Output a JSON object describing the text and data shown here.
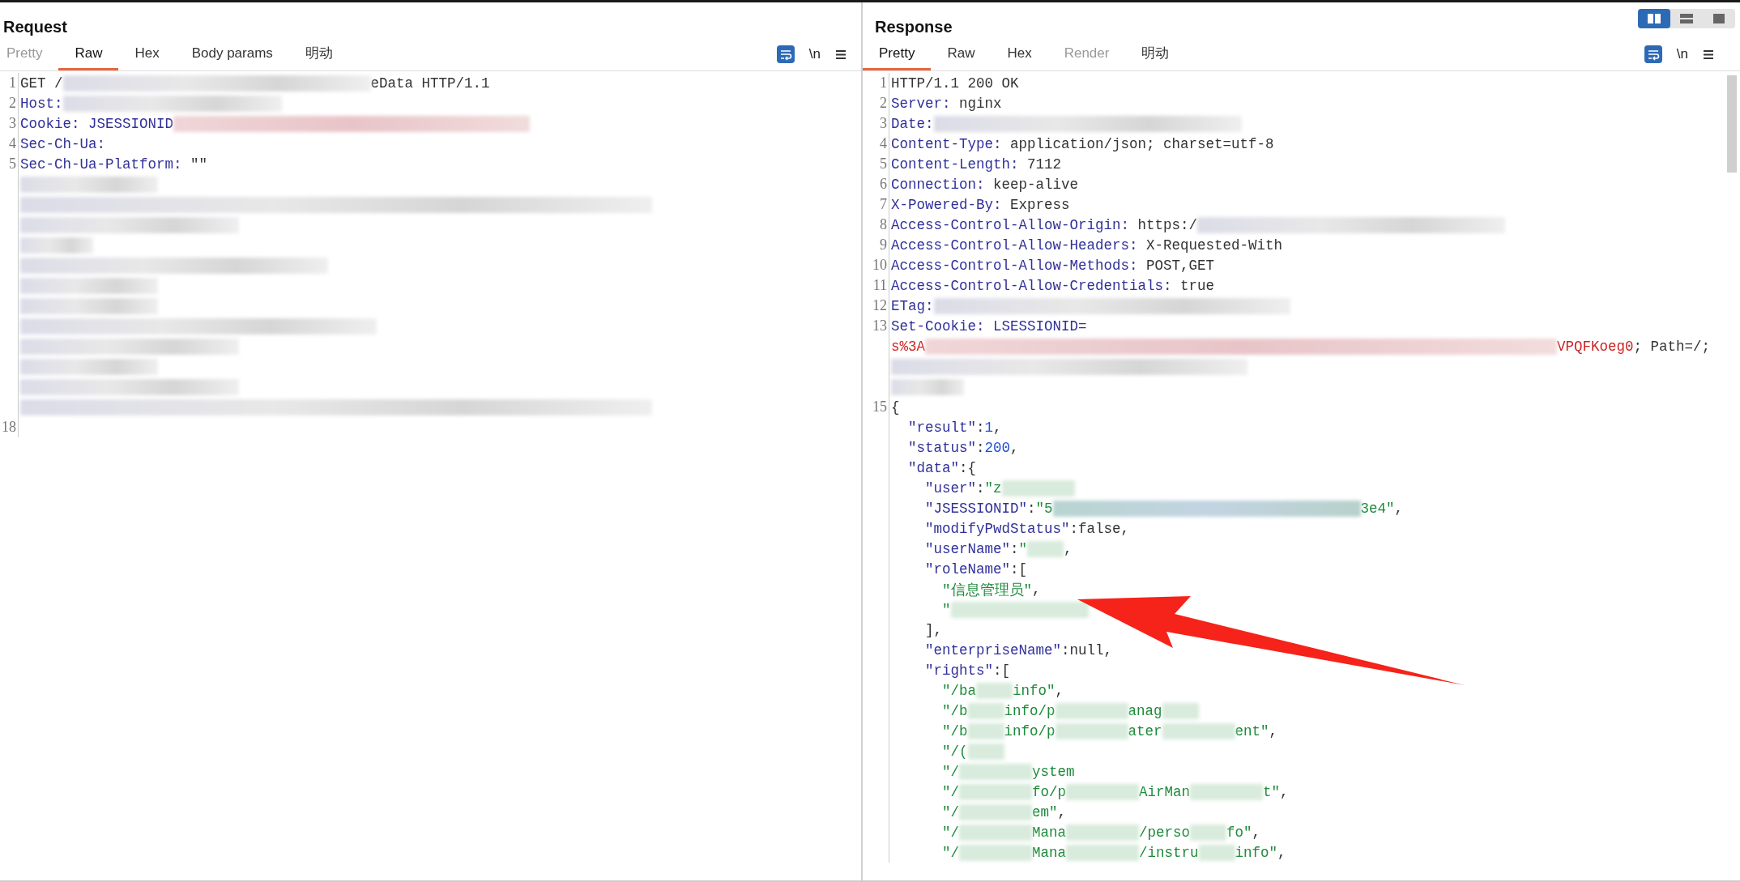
{
  "request": {
    "title": "Request",
    "tabs": [
      {
        "label": "Pretty",
        "selected": false,
        "disabled": true
      },
      {
        "label": "Raw",
        "selected": true,
        "disabled": false
      },
      {
        "label": "Hex",
        "selected": false,
        "disabled": false
      },
      {
        "label": "Body params",
        "selected": false,
        "disabled": false
      },
      {
        "label": "明动",
        "selected": false,
        "disabled": false
      }
    ],
    "newline_toggle": "\\n",
    "lines": [
      {
        "number": "1",
        "parts": [
          {
            "kind": "plain",
            "text": "GET /"
          },
          {
            "kind": "blur-xl"
          },
          {
            "kind": "plain",
            "text": "eData HTTP/1.1"
          }
        ]
      },
      {
        "number": "2",
        "parts": [
          {
            "kind": "key",
            "text": "Host:"
          },
          {
            "kind": "blur-l"
          }
        ]
      },
      {
        "number": "3",
        "parts": [
          {
            "kind": "key",
            "text": "Cookie: JSESSIONID"
          },
          {
            "kind": "redblur-xxl"
          }
        ]
      },
      {
        "number": "4",
        "parts": [
          {
            "kind": "key",
            "text": "Sec-Ch-Ua:"
          }
        ]
      },
      {
        "number": "5",
        "parts": [
          {
            "kind": "key",
            "text": "Sec-Ch-Ua-Platform:"
          },
          {
            "kind": "plain",
            "text": " \"\""
          }
        ]
      },
      {
        "parts": [
          {
            "kind": "blur-m"
          }
        ]
      },
      {
        "parts": [
          {
            "kind": "blur-full"
          }
        ]
      },
      {
        "parts": [
          {
            "kind": "blur-l"
          }
        ]
      },
      {
        "parts": [
          {
            "kind": "blur-s"
          }
        ]
      },
      {
        "parts": [
          {
            "kind": "blur-xl"
          }
        ]
      },
      {
        "parts": [
          {
            "kind": "blur-m"
          }
        ]
      },
      {
        "parts": [
          {
            "kind": "blur-m"
          }
        ]
      },
      {
        "parts": [
          {
            "kind": "blur-xxl"
          }
        ]
      },
      {
        "parts": [
          {
            "kind": "blur-l"
          }
        ]
      },
      {
        "parts": [
          {
            "kind": "blur-m"
          }
        ]
      },
      {
        "parts": [
          {
            "kind": "blur-l"
          }
        ]
      },
      {
        "parts": [
          {
            "kind": "blur-full"
          }
        ]
      },
      {
        "number": "18"
      }
    ]
  },
  "response": {
    "title": "Response",
    "layout_buttons": [
      {
        "selected": true
      },
      {
        "selected": false
      },
      {
        "selected": false
      }
    ],
    "tabs": [
      {
        "label": "Pretty",
        "selected": true,
        "disabled": false
      },
      {
        "label": "Raw",
        "selected": false,
        "disabled": false
      },
      {
        "label": "Hex",
        "selected": false,
        "disabled": false
      },
      {
        "label": "Render",
        "selected": false,
        "disabled": true
      },
      {
        "label": "明动",
        "selected": false,
        "disabled": false
      }
    ],
    "newline_toggle": "\\n",
    "lines": [
      {
        "number": "1",
        "parts": [
          {
            "kind": "plain",
            "text": "HTTP/1.1 200 OK"
          }
        ]
      },
      {
        "number": "2",
        "parts": [
          {
            "kind": "key",
            "text": "Server:"
          },
          {
            "kind": "plain",
            "text": " nginx"
          }
        ]
      },
      {
        "number": "3",
        "parts": [
          {
            "kind": "key",
            "text": "Date:"
          },
          {
            "kind": "blur-xl"
          }
        ]
      },
      {
        "number": "4",
        "parts": [
          {
            "kind": "key",
            "text": "Content-Type:"
          },
          {
            "kind": "plain",
            "text": " application/json; charset=utf-8"
          }
        ]
      },
      {
        "number": "5",
        "parts": [
          {
            "kind": "key",
            "text": "Content-Length:"
          },
          {
            "kind": "plain",
            "text": " 7112"
          }
        ]
      },
      {
        "number": "6",
        "parts": [
          {
            "kind": "key",
            "text": "Connection:"
          },
          {
            "kind": "plain",
            "text": " keep-alive"
          }
        ]
      },
      {
        "number": "7",
        "parts": [
          {
            "kind": "key",
            "text": "X-Powered-By:"
          },
          {
            "kind": "plain",
            "text": " Express"
          }
        ]
      },
      {
        "number": "8",
        "parts": [
          {
            "kind": "key",
            "text": "Access-Control-Allow-Origin:"
          },
          {
            "kind": "plain",
            "text": " https:/"
          },
          {
            "kind": "blur-xl"
          }
        ]
      },
      {
        "number": "9",
        "parts": [
          {
            "kind": "key",
            "text": "Access-Control-Allow-Headers:"
          },
          {
            "kind": "plain",
            "text": " X-Requested-With"
          }
        ]
      },
      {
        "number": "10",
        "parts": [
          {
            "kind": "key",
            "text": "Access-Control-Allow-Methods:"
          },
          {
            "kind": "plain",
            "text": " POST,GET"
          }
        ]
      },
      {
        "number": "11",
        "parts": [
          {
            "kind": "key",
            "text": "Access-Control-Allow-Credentials:"
          },
          {
            "kind": "plain",
            "text": " true"
          }
        ]
      },
      {
        "number": "12",
        "parts": [
          {
            "kind": "key",
            "text": "ETag:"
          },
          {
            "kind": "blur-xxl"
          }
        ]
      },
      {
        "number": "13",
        "parts": [
          {
            "kind": "key",
            "text": "Set-Cookie: LSESSIONID="
          }
        ]
      },
      {
        "parts": [
          {
            "kind": "red",
            "text": "s%3A"
          },
          {
            "kind": "redblur-full"
          },
          {
            "kind": "red",
            "text": "VPQFKoeg0"
          },
          {
            "kind": "plain",
            "text": "; Path=/;"
          }
        ]
      },
      {
        "parts": [
          {
            "kind": "blur-xxl"
          }
        ]
      },
      {
        "parts": [
          {
            "kind": "blur-s"
          }
        ]
      },
      {
        "number": "15",
        "parts": [
          {
            "kind": "plain",
            "text": "{"
          }
        ]
      },
      {
        "parts": [
          {
            "kind": "key",
            "text": "  \"result\""
          },
          {
            "kind": "plain",
            "text": ":"
          },
          {
            "kind": "num",
            "text": "1"
          },
          {
            "kind": "plain",
            "text": ","
          }
        ]
      },
      {
        "parts": [
          {
            "kind": "key",
            "text": "  \"status\""
          },
          {
            "kind": "plain",
            "text": ":"
          },
          {
            "kind": "num",
            "text": "200"
          },
          {
            "kind": "plain",
            "text": ","
          }
        ]
      },
      {
        "parts": [
          {
            "kind": "key",
            "text": "  \"data\""
          },
          {
            "kind": "plain",
            "text": ":{"
          }
        ]
      },
      {
        "parts": [
          {
            "kind": "key",
            "text": "    \"user\""
          },
          {
            "kind": "plain",
            "text": ":"
          },
          {
            "kind": "str",
            "text": "\"z"
          },
          {
            "kind": "greenblur-s"
          }
        ]
      },
      {
        "parts": [
          {
            "kind": "key",
            "text": "    \"JSESSIONID\""
          },
          {
            "kind": "plain",
            "text": ":"
          },
          {
            "kind": "str",
            "text": "\"5"
          },
          {
            "kind": "tealblur-xl"
          },
          {
            "kind": "str",
            "text": "3e4\""
          },
          {
            "kind": "plain",
            "text": ","
          }
        ]
      },
      {
        "parts": [
          {
            "kind": "key",
            "text": "    \"modifyPwdStatus\""
          },
          {
            "kind": "plain",
            "text": ":false,"
          }
        ]
      },
      {
        "parts": [
          {
            "kind": "key",
            "text": "    \"userName\""
          },
          {
            "kind": "plain",
            "text": ":"
          },
          {
            "kind": "str",
            "text": "\""
          },
          {
            "kind": "greenblur-xs"
          },
          {
            "kind": "plain",
            "text": ","
          }
        ]
      },
      {
        "parts": [
          {
            "kind": "key",
            "text": "    \"roleName\""
          },
          {
            "kind": "plain",
            "text": ":["
          }
        ]
      },
      {
        "parts": [
          {
            "kind": "str",
            "text": "      \"信息管理员\""
          },
          {
            "kind": "plain",
            "text": ","
          }
        ]
      },
      {
        "parts": [
          {
            "kind": "str",
            "text": "      \""
          },
          {
            "kind": "greenblur-m"
          }
        ]
      },
      {
        "parts": [
          {
            "kind": "plain",
            "text": "    ],"
          }
        ]
      },
      {
        "parts": [
          {
            "kind": "key",
            "text": "    \"enterpriseName\""
          },
          {
            "kind": "plain",
            "text": ":null,"
          }
        ]
      },
      {
        "parts": [
          {
            "kind": "key",
            "text": "    \"rights\""
          },
          {
            "kind": "plain",
            "text": ":["
          }
        ]
      },
      {
        "parts": [
          {
            "kind": "str",
            "text": "      \"/ba"
          },
          {
            "kind": "greenblur-xs"
          },
          {
            "kind": "str",
            "text": "info\""
          },
          {
            "kind": "plain",
            "text": ","
          }
        ]
      },
      {
        "parts": [
          {
            "kind": "str",
            "text": "      \"/b"
          },
          {
            "kind": "greenblur-xs"
          },
          {
            "kind": "str",
            "text": "info/p"
          },
          {
            "kind": "greenblur-s"
          },
          {
            "kind": "str",
            "text": "anag"
          },
          {
            "kind": "greenblur-xs"
          }
        ]
      },
      {
        "parts": [
          {
            "kind": "str",
            "text": "      \"/b"
          },
          {
            "kind": "greenblur-xs"
          },
          {
            "kind": "str",
            "text": "info/p"
          },
          {
            "kind": "greenblur-s"
          },
          {
            "kind": "str",
            "text": "ater"
          },
          {
            "kind": "greenblur-s"
          },
          {
            "kind": "str",
            "text": "ent\""
          },
          {
            "kind": "plain",
            "text": ","
          }
        ]
      },
      {
        "parts": [
          {
            "kind": "str",
            "text": "      \"/("
          },
          {
            "kind": "greenblur-xs"
          }
        ]
      },
      {
        "parts": [
          {
            "kind": "str",
            "text": "      \"/"
          },
          {
            "kind": "greenblur-s"
          },
          {
            "kind": "str",
            "text": "ystem"
          }
        ]
      },
      {
        "parts": [
          {
            "kind": "str",
            "text": "      \"/"
          },
          {
            "kind": "greenblur-s"
          },
          {
            "kind": "str",
            "text": "fo/p"
          },
          {
            "kind": "greenblur-s"
          },
          {
            "kind": "str",
            "text": "AirMan"
          },
          {
            "kind": "greenblur-s"
          },
          {
            "kind": "str",
            "text": "t\""
          },
          {
            "kind": "plain",
            "text": ","
          }
        ]
      },
      {
        "parts": [
          {
            "kind": "str",
            "text": "      \"/"
          },
          {
            "kind": "greenblur-s"
          },
          {
            "kind": "str",
            "text": "em\""
          },
          {
            "kind": "plain",
            "text": ","
          }
        ]
      },
      {
        "parts": [
          {
            "kind": "str",
            "text": "      \"/"
          },
          {
            "kind": "greenblur-s"
          },
          {
            "kind": "str",
            "text": "Mana"
          },
          {
            "kind": "greenblur-s"
          },
          {
            "kind": "str",
            "text": "/perso"
          },
          {
            "kind": "greenblur-xs"
          },
          {
            "kind": "str",
            "text": "fo\""
          },
          {
            "kind": "plain",
            "text": ","
          }
        ]
      },
      {
        "parts": [
          {
            "kind": "str",
            "text": "      \"/"
          },
          {
            "kind": "greenblur-s"
          },
          {
            "kind": "str",
            "text": "Mana"
          },
          {
            "kind": "greenblur-s"
          },
          {
            "kind": "str",
            "text": "/instru"
          },
          {
            "kind": "greenblur-xs"
          },
          {
            "kind": "str",
            "text": "info\""
          },
          {
            "kind": "plain",
            "text": ","
          }
        ]
      }
    ]
  }
}
